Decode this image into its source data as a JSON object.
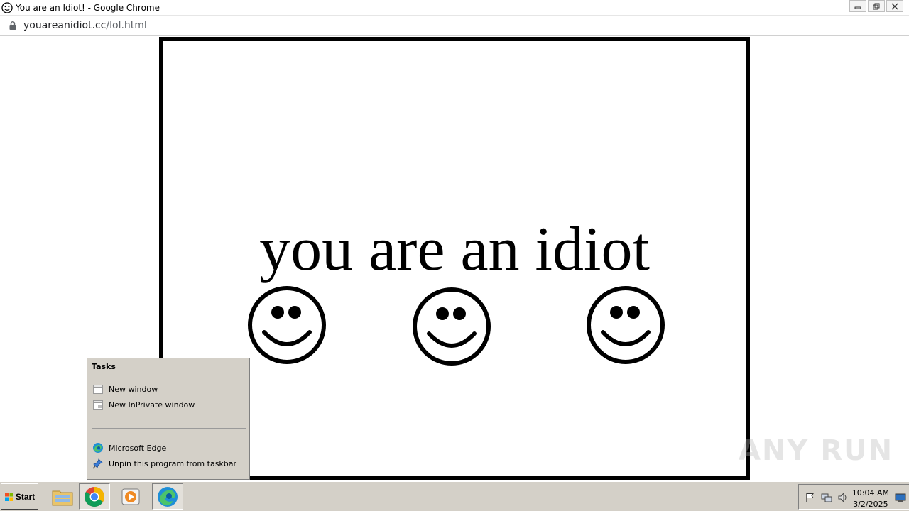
{
  "window": {
    "title": "You are an Idiot! - Google Chrome",
    "controls": {
      "minimize": "–",
      "restore": "❐",
      "close": "✕"
    }
  },
  "address": {
    "host": "youareanidiot.cc",
    "path": "/lol.html"
  },
  "page": {
    "headline": "you are an idiot",
    "smileys": [
      "smiley-face",
      "smiley-face",
      "smiley-face"
    ]
  },
  "jumplist": {
    "heading": "Tasks",
    "tasks": [
      {
        "label": "New window",
        "icon": "window-icon"
      },
      {
        "label": "New InPrivate window",
        "icon": "inprivate-window-icon"
      }
    ],
    "items": [
      {
        "label": "Microsoft Edge",
        "icon": "edge-icon"
      },
      {
        "label": "Unpin this program from taskbar",
        "icon": "unpin-icon"
      }
    ]
  },
  "watermark": "ANY RUN",
  "taskbar": {
    "start_label": "Start",
    "apps": [
      "file-explorer-icon",
      "chrome-icon",
      "media-player-icon",
      "edge-icon"
    ],
    "clock": {
      "time": "10:04 AM",
      "date": "3/2/2025"
    }
  },
  "colors": {
    "taskbar": "#d4d0c8",
    "frame_border": "#000000"
  }
}
